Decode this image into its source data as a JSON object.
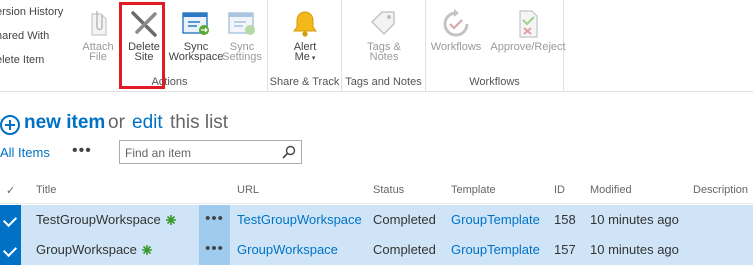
{
  "ribbon": {
    "left_list": [
      "ersion History",
      "hared With",
      "elete Item"
    ],
    "groups": [
      {
        "id": "actions",
        "label": "Actions",
        "buttons": [
          {
            "label1": "Attach",
            "label2": "File",
            "icon": "paperclip-icon",
            "disabled": true
          },
          {
            "label1": "Delete",
            "label2": "Site",
            "icon": "delete-x-icon",
            "disabled": false
          },
          {
            "label1": "Sync",
            "label2": "Workspace",
            "icon": "sync-workspace-icon",
            "disabled": false
          },
          {
            "label1": "Sync",
            "label2": "Settings",
            "icon": "sync-settings-icon",
            "disabled": true
          }
        ]
      },
      {
        "id": "share-track",
        "label": "Share & Track",
        "buttons": [
          {
            "label1": "Alert",
            "label2": "Me",
            "icon": "bell-icon",
            "disabled": false
          }
        ]
      },
      {
        "id": "tags-notes",
        "label": "Tags and Notes",
        "buttons": [
          {
            "label1": "Tags &",
            "label2": "Notes",
            "icon": "tag-icon",
            "disabled": true
          }
        ]
      },
      {
        "id": "workflows",
        "label": "Workflows",
        "buttons": [
          {
            "label1": "Workflows",
            "label2": "",
            "icon": "workflow-icon",
            "disabled": true
          },
          {
            "label1": "Approve/Reject",
            "label2": "",
            "icon": "approve-reject-icon",
            "disabled": true
          }
        ]
      }
    ]
  },
  "list_header": {
    "new_item": "new item",
    "or": "or",
    "edit": "edit",
    "this_list": "this list"
  },
  "view": {
    "all_items": "All Items",
    "more": "•••",
    "search_placeholder": "Find an item"
  },
  "columns": [
    "Title",
    "URL",
    "Status",
    "Template",
    "ID",
    "Modified",
    "Description"
  ],
  "rows": [
    {
      "title": "TestGroupWorkspace",
      "url": "TestGroupWorkspace",
      "status": "Completed",
      "template": "GroupTemplate",
      "id": "158",
      "modified": "10 minutes ago",
      "description": ""
    },
    {
      "title": "GroupWorkspace",
      "url": "GroupWorkspace",
      "status": "Completed",
      "template": "GroupTemplate",
      "id": "157",
      "modified": "10 minutes ago",
      "description": ""
    }
  ],
  "colors": {
    "accent": "#0072c6",
    "selected_row": "#cfe5f7",
    "highlight": "#e01b24"
  }
}
